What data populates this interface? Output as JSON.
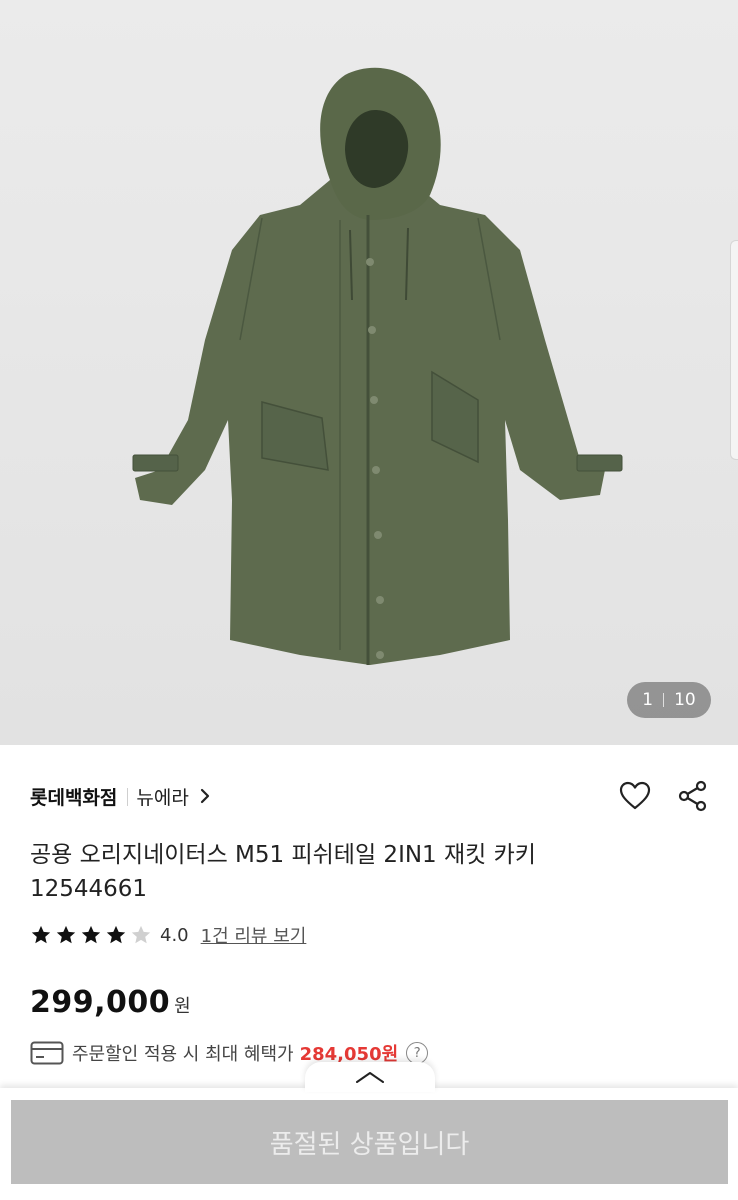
{
  "gallery": {
    "image_alt": "",
    "current_page": "1",
    "total_pages": "10"
  },
  "product": {
    "brand": "롯데백화점",
    "sub_brand": "뉴에라",
    "title": "공용 오리지네이터스 M51 피쉬테일 2IN1 재킷 카키 12544661",
    "rating_value": "4.0",
    "rating_stars": 4,
    "review_link": "1건 리뷰 보기",
    "price": "299,000",
    "price_unit": "원",
    "benefit_text": "주문할인 적용 시 최대 혜택가",
    "benefit_price": "284,050원"
  },
  "icons": {
    "brand_chevron": "chevron-right-icon",
    "wishlist": "heart-icon",
    "share": "share-icon",
    "card": "credit-card-icon",
    "help": "question-circle-icon",
    "sheet_toggle": "chevron-up-icon"
  },
  "colors": {
    "accent_red": "#e53935",
    "jacket": "#5c6b4c",
    "disabled_button": "#bdbdbd"
  },
  "bottom_bar": {
    "soldout_label": "품절된 상품입니다"
  }
}
